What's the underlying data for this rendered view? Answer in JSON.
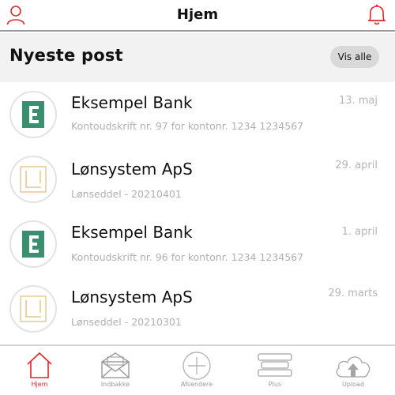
{
  "header": {
    "title": "Hjem",
    "left_icon": "user-icon",
    "right_icon": "bell-icon",
    "accent": "#d92a2a"
  },
  "section": {
    "heading": "Nyeste post",
    "see_all_label": "Vis alle"
  },
  "messages": [
    {
      "sender": "Eksempel Bank",
      "subject": "Kontoudskrift nr. 97 for kontonr. 1234 1234567",
      "date": "13. maj",
      "logo": "bank-logo"
    },
    {
      "sender": "Lønsystem ApS",
      "subject": "Lønseddel - 20210401",
      "date": "29. april",
      "logo": "payroll-logo"
    },
    {
      "sender": "Eksempel Bank",
      "subject": "Kontoudskrift nr. 96 for kontonr. 1234 1234567",
      "date": "1. april",
      "logo": "bank-logo"
    },
    {
      "sender": "Lønsystem ApS",
      "subject": "Lønseddel - 20210301",
      "date": "29. marts",
      "logo": "payroll-logo"
    }
  ],
  "tabs": [
    {
      "label": "Hjem",
      "icon": "home-icon",
      "active": true
    },
    {
      "label": "Indbakke",
      "icon": "inbox-icon",
      "active": false
    },
    {
      "label": "Afsendere",
      "icon": "plus-circle-icon",
      "active": false
    },
    {
      "label": "Plus",
      "icon": "stack-icon",
      "active": false
    },
    {
      "label": "Upload",
      "icon": "cloud-upload-icon",
      "active": false
    }
  ],
  "colors": {
    "bank_green": "#3a8f6e",
    "payroll_gold": "#e2c98f",
    "muted_text": "#b0b0b0"
  }
}
